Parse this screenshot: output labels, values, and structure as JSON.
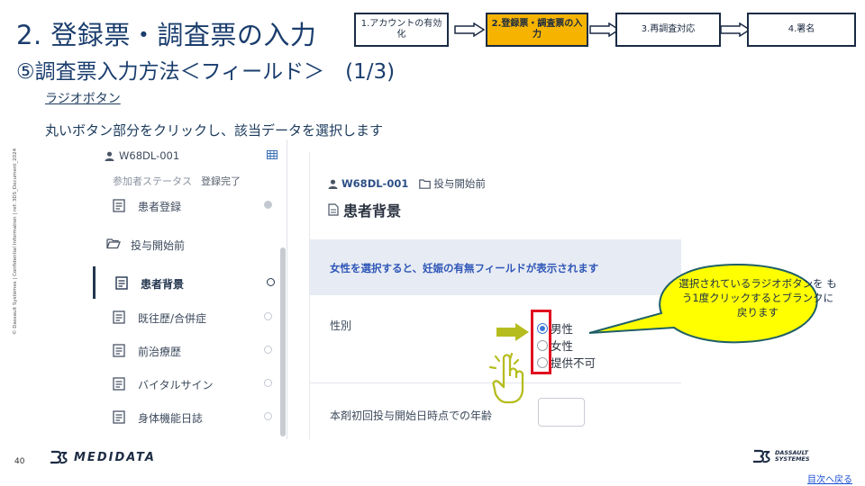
{
  "header": {
    "title_line1": "2. 登録票・調査票の入力",
    "title_line2": "⑤調査票入力方法＜フィールド＞　(1/3)"
  },
  "steps": [
    {
      "label": "1.アカウントの有効化",
      "active": false
    },
    {
      "label": "2.登録票・調査票の入力",
      "active": true
    },
    {
      "label": "3.再調査対応",
      "active": false
    },
    {
      "label": "4.署名",
      "active": false
    }
  ],
  "intro": {
    "section_link": "ラジオボタン",
    "instruction": "丸いボタン部分をクリックし、該当データを選択します"
  },
  "confidential_note": "© Dassault Systèmes | Confidential Information | ref: 3DS_Document_2024",
  "app": {
    "sidebar": {
      "subject_id": "W68DL-001",
      "status_label": "参加者ステータス",
      "status_value": "登録完了",
      "items": [
        {
          "label": "患者登録",
          "type": "form",
          "state": "filled"
        },
        {
          "label": "投与開始前",
          "type": "folder",
          "state": "none"
        },
        {
          "label": "患者背景",
          "type": "form",
          "state": "active"
        },
        {
          "label": "既往歴/合併症",
          "type": "form",
          "state": "empty"
        },
        {
          "label": "前治療歴",
          "type": "form",
          "state": "empty"
        },
        {
          "label": "バイタルサイン",
          "type": "form",
          "state": "empty"
        },
        {
          "label": "身体機能日誌",
          "type": "form",
          "state": "empty"
        }
      ]
    },
    "main": {
      "subject_id": "W68DL-001",
      "folder": "投与開始前",
      "form_title": "患者背景",
      "banner": "女性を選択すると、妊娠の有無フィールドが表示されます",
      "sex_label": "性別",
      "sex_options": [
        "男性",
        "女性",
        "提供不可"
      ],
      "sex_selected": 0,
      "age_label": "本剤初回投与開始日時点での年齢",
      "age_value": ""
    }
  },
  "callout": {
    "text": "選択されているラジオボタンを もう1度クリックするとブランクに戻ります"
  },
  "footer": {
    "page_number": "40",
    "logo_left": "MEDIDATA",
    "logo_right_line1": "DASSAULT",
    "logo_right_line2": "SYSTEMES",
    "back_link": "目次へ戻る"
  },
  "colors": {
    "title": "#1a3d6d",
    "active_step": "#f6b400",
    "banner_bg": "#e7ebf3",
    "banner_text": "#2f57b8",
    "callout_fill": "#ffff00",
    "callout_border": "#1f5f66",
    "highlight_box": "#e01020",
    "pointer_arrow": "#b5bd1e"
  }
}
